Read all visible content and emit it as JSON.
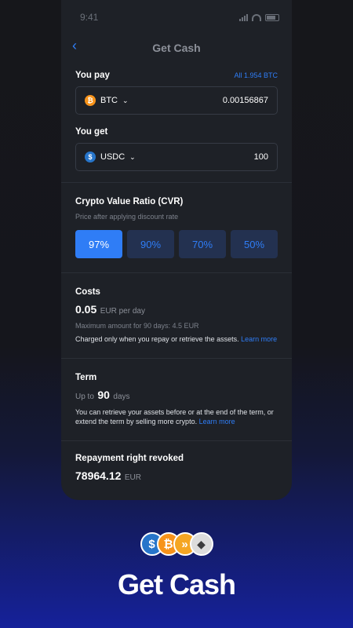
{
  "status_bar": {
    "time": "9:41"
  },
  "header": {
    "title": "Get Cash",
    "back_icon": "chevron-left-icon"
  },
  "pay": {
    "label": "You pay",
    "all_link": "All 1.954  BTC",
    "coin": "BTC",
    "amount": "0.00156867"
  },
  "get": {
    "label": "You get",
    "coin": "USDC",
    "amount": "100"
  },
  "cvr": {
    "title": "Crypto Value Ratio (CVR)",
    "subtitle": "Price after applying discount rate",
    "options": [
      "97%",
      "90%",
      "70%",
      "50%"
    ],
    "selected_index": 0
  },
  "costs": {
    "title": "Costs",
    "amount": "0.05",
    "unit": "EUR per day",
    "max_text": "Maximum amount for 90 days: 4.5 EUR",
    "note": "Charged only when you repay or retrieve the assets.",
    "link": "Learn more"
  },
  "term": {
    "title": "Term",
    "prefix": "Up to",
    "days": "90",
    "suffix": "days",
    "note": "You can retrieve your assets before or at the end of the term, or extend the term by selling more crypto.",
    "link": "Learn more"
  },
  "repayment": {
    "title": "Repayment right revoked",
    "amount": "78964.12",
    "unit": "EUR"
  },
  "brand": {
    "headline": "Get Cash",
    "logo_icons": [
      "usdc-icon",
      "bitcoin-icon",
      "bitfinex-icon",
      "ethereum-icon"
    ],
    "colors": {
      "accent": "#2f7df6",
      "btc": "#f7931a",
      "usdc": "#2775ca"
    }
  }
}
